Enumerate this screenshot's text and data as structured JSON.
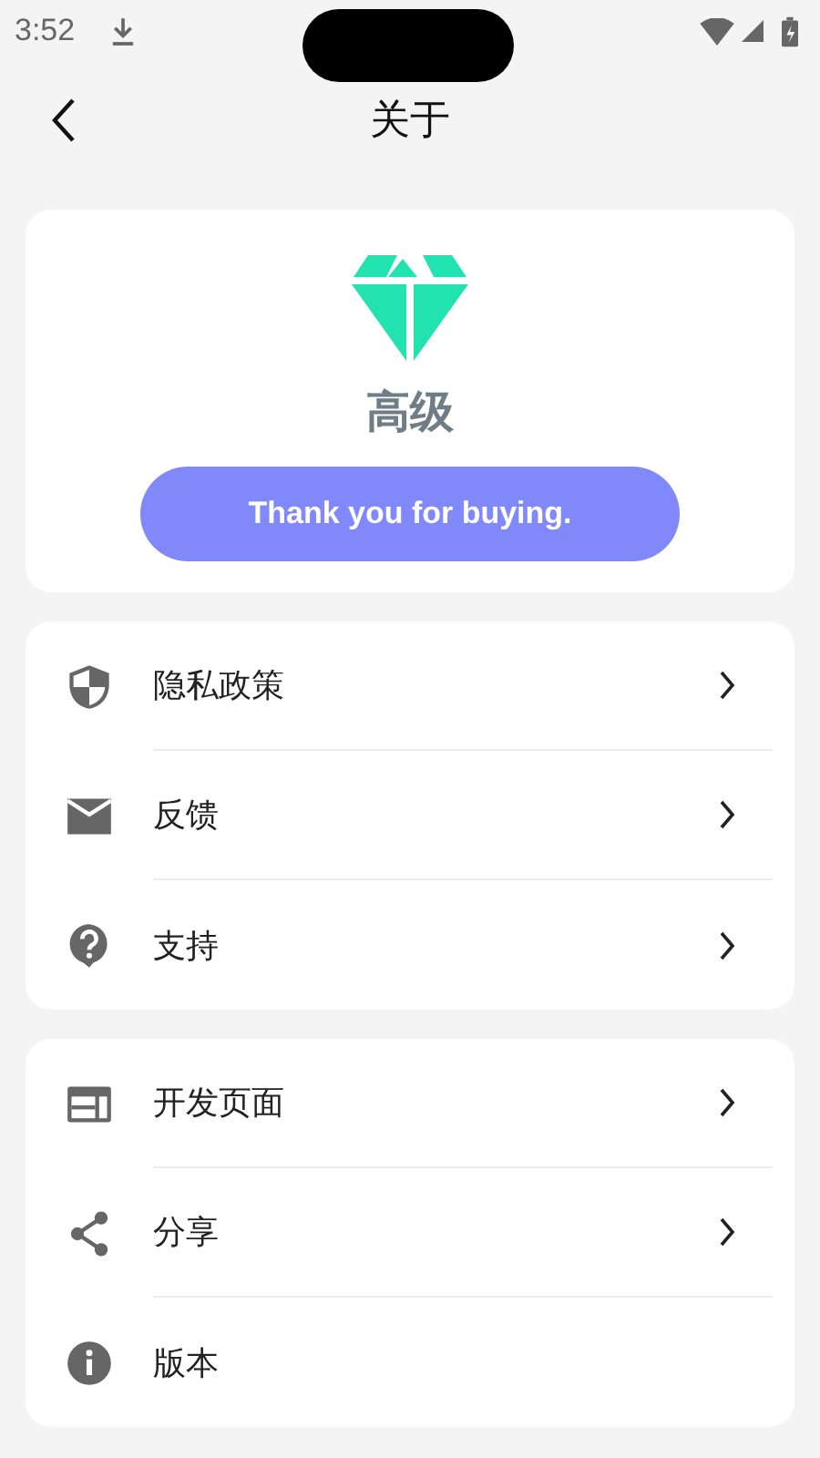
{
  "status_bar": {
    "time": "3:52"
  },
  "header": {
    "title": "关于"
  },
  "premium": {
    "title": "高级",
    "button": "Thank you for buying."
  },
  "groups": [
    {
      "items": [
        {
          "kind": "shield",
          "label": "隐私政策",
          "chevron": true
        },
        {
          "kind": "mail",
          "label": "反馈",
          "chevron": true
        },
        {
          "kind": "help",
          "label": "支持",
          "chevron": true
        }
      ]
    },
    {
      "items": [
        {
          "kind": "web",
          "label": "开发页面",
          "chevron": true
        },
        {
          "kind": "share",
          "label": "分享",
          "chevron": true
        },
        {
          "kind": "info",
          "label": "版本",
          "chevron": false
        }
      ]
    }
  ]
}
